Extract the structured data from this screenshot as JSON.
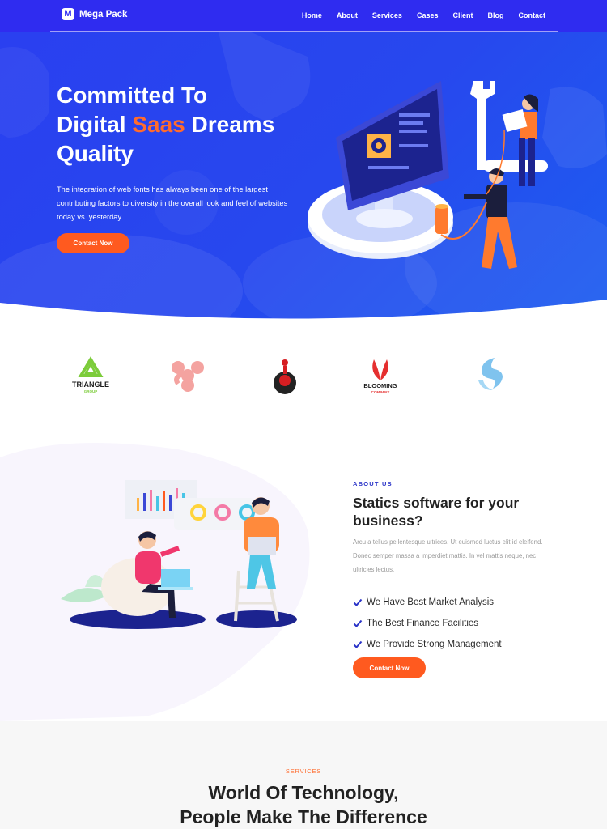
{
  "brand": {
    "logo_letter": "M",
    "name": "Mega Pack"
  },
  "nav": {
    "items": [
      "Home",
      "About",
      "Services",
      "Cases",
      "Client",
      "Blog",
      "Contact"
    ]
  },
  "hero": {
    "title_line1": "Committed To",
    "title_line2_pre": "Digital ",
    "title_accent": "Saas",
    "title_line2_post": " Dreams",
    "title_line3": "Quality",
    "description": "The integration of web fonts has always been one of the largest contributing factors to diversity in the overall look and feel of websites today vs. yesterday.",
    "cta": "Contact Now"
  },
  "clients": [
    {
      "name": "TRIANGLE",
      "sub": "GROUP",
      "icon": "triangle-logo"
    },
    {
      "name": "",
      "sub": "",
      "icon": "pink-molecule-logo"
    },
    {
      "name": "",
      "sub": "",
      "icon": "red-drop-logo"
    },
    {
      "name": "BLOOMING",
      "sub": "COMPANY",
      "icon": "blooming-leaf-logo"
    },
    {
      "name": "",
      "sub": "",
      "icon": "blue-s-logo"
    }
  ],
  "about": {
    "eyebrow": "ABOUT US",
    "title": "Statics software for your business?",
    "description": "Arcu a tellus pellentesque ultrices. Ut euismod luctus elit id eleifend. Donec semper massa a imperdiet mattis. In vel mattis neque, nec ultricies lectus.",
    "features": [
      "We Have Best Market Analysis",
      "The Best Finance Facilities",
      "We Provide Strong Management"
    ],
    "cta": "Contact Now"
  },
  "services": {
    "eyebrow": "SERVICES",
    "title_line1": "World Of Technology,",
    "title_line2": "People Make The Difference"
  },
  "colors": {
    "primary": "#2f2cf0",
    "accent": "#ff5a1f",
    "check": "#2b34c8"
  }
}
